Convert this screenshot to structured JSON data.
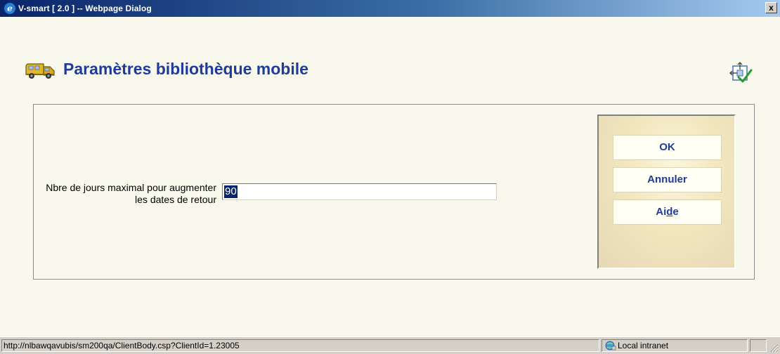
{
  "window": {
    "title": "V-smart [ 2.0 ] -- Webpage Dialog",
    "close_glyph": "x"
  },
  "header": {
    "title": "Paramètres bibliothèque mobile",
    "icon": "mobile-library-van-icon",
    "layout_icon": "layout-settings-icon"
  },
  "form": {
    "label": "Nbre de jours maximal pour augmenter les dates de retour",
    "value": "90"
  },
  "buttons": {
    "ok": "OK",
    "cancel": "Annuler",
    "help_prefix": "Ai",
    "help_underlined": "d",
    "help_suffix": "e"
  },
  "statusbar": {
    "url": "http://nlbawqavubis/sm200qa/ClientBody.csp?ClientId=1.23005",
    "zone": "Local intranet"
  },
  "colors": {
    "title_blue": "#1f3c9c",
    "background": "#f8f8ec",
    "titlebar_start": "#0a246a"
  }
}
